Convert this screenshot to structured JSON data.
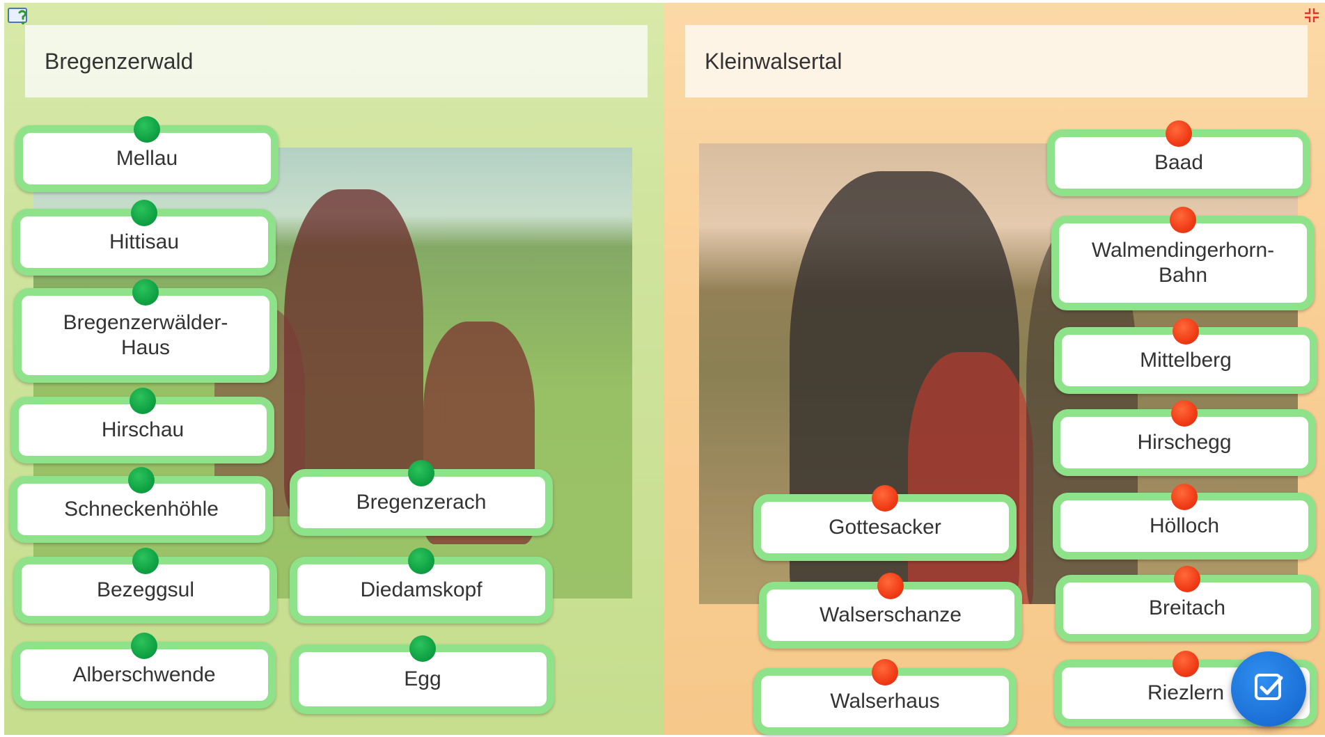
{
  "left": {
    "title": "Bregenzerwald",
    "cards": [
      {
        "label": "Mellau",
        "dot": "green"
      },
      {
        "label": "Hittisau",
        "dot": "green"
      },
      {
        "label": "Bregenzerwälder-\nHaus",
        "dot": "green"
      },
      {
        "label": "Hirschau",
        "dot": "green"
      },
      {
        "label": "Schneckenhöhle",
        "dot": "green"
      },
      {
        "label": "Bezeggsul",
        "dot": "green"
      },
      {
        "label": "Alberschwende",
        "dot": "green"
      },
      {
        "label": "Bregenzerach",
        "dot": "green"
      },
      {
        "label": "Diedamskopf",
        "dot": "green"
      },
      {
        "label": "Egg",
        "dot": "green"
      }
    ]
  },
  "right": {
    "title": "Kleinwalsertal",
    "cards": [
      {
        "label": "Baad",
        "dot": "red"
      },
      {
        "label": "Walmendingerhorn-\nBahn",
        "dot": "red"
      },
      {
        "label": "Mittelberg",
        "dot": "red"
      },
      {
        "label": "Hirschegg",
        "dot": "red"
      },
      {
        "label": "Hölloch",
        "dot": "red"
      },
      {
        "label": "Breitach",
        "dot": "red"
      },
      {
        "label": "Riezlern",
        "dot": "red"
      },
      {
        "label": "Gottesacker",
        "dot": "red"
      },
      {
        "label": "Walserschanze",
        "dot": "red"
      },
      {
        "label": "Walserhaus",
        "dot": "red"
      }
    ]
  },
  "icons": {
    "help": "help-icon",
    "fullscreen": "fullscreen-exit-icon",
    "check": "check-icon"
  },
  "colors": {
    "card_border": "#8ee28a",
    "dot_green": "#10a244",
    "dot_red": "#f03b16",
    "check_button": "#1b6fd6"
  }
}
